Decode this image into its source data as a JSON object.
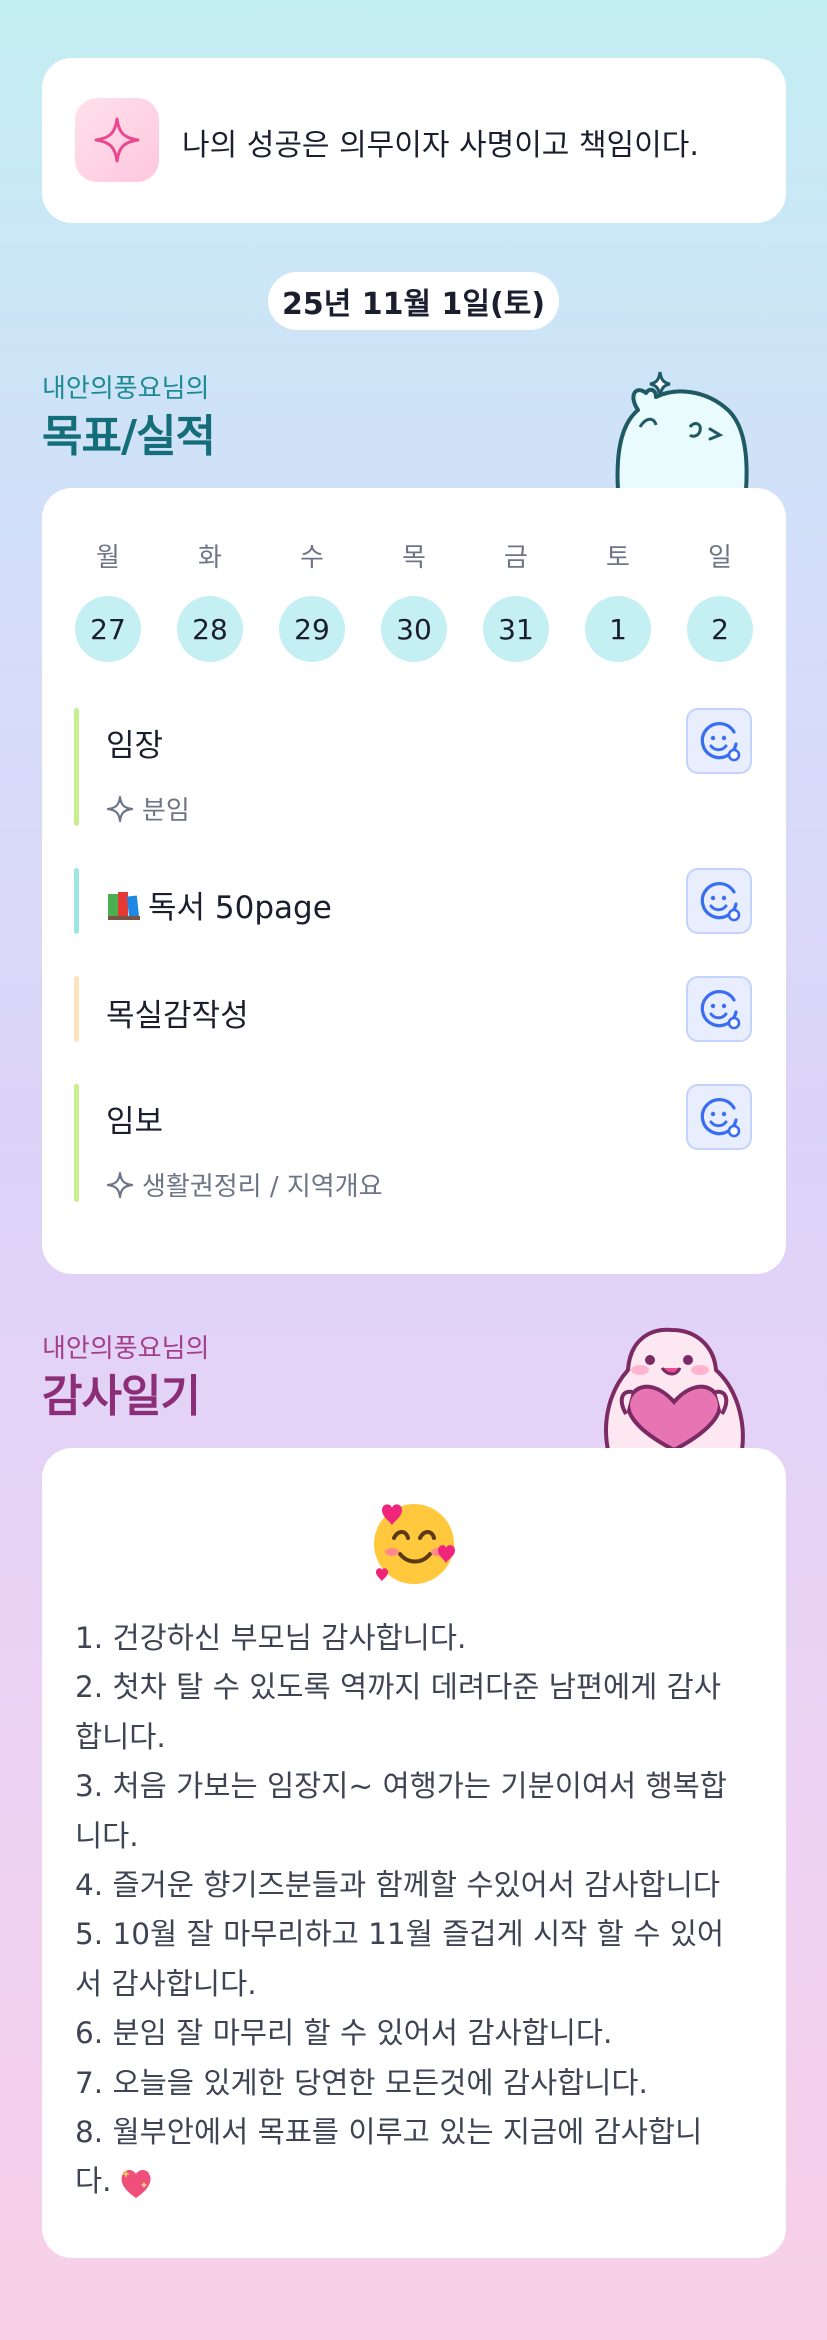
{
  "quote": {
    "text": "나의 성공은 의무이자 사명이고 책임이다.",
    "icon": "sparkle-icon"
  },
  "date": {
    "label": "25년 11월 1일(토)"
  },
  "goals_section": {
    "subtitle": "내안의풍요님의",
    "title": "목표/실적"
  },
  "week": {
    "days": [
      "월",
      "화",
      "수",
      "목",
      "금",
      "토",
      "일"
    ],
    "dates": [
      "27",
      "28",
      "29",
      "30",
      "31",
      "1",
      "2"
    ]
  },
  "goals": [
    {
      "name": "임장",
      "sub": "분임",
      "bar_color": "#c7ee8f"
    },
    {
      "name": "독서 50page",
      "emoji": "books",
      "bar_color": "#9ee6e3"
    },
    {
      "name": "목실감작성",
      "bar_color": "#fde3bd"
    },
    {
      "name": "임보",
      "sub": "생활권정리 / 지역개요",
      "bar_color": "#c7ee8f"
    }
  ],
  "gratitude_section": {
    "subtitle": "내안의풍요님의",
    "title": "감사일기"
  },
  "gratitude": {
    "emoji": "smiling-face-with-hearts",
    "lines": [
      "1. 건강하신 부모님 감사합니다.",
      "2. 첫차 탈 수 있도록 역까지 데려다준 남편에게 감사",
      "합니다.",
      "3. 처음 가보는 임장지~ 여행가는 기분이여서 행복합",
      "니다.",
      "4. 즐거운 향기즈분들과 함께할 수있어서 감사합니다",
      "5. 10월 잘 마무리하고 11월 즐겁게 시작 할 수 있어",
      "서 감사합니다.",
      "6. 분임 잘 마무리 할 수 있어서 감사합니다.",
      "7. 오늘을 있게한  당연한 모든것에 감사합니다.",
      "8. 월부안에서 목표를 이루고 있는 지금에 감사합니",
      "다."
    ]
  },
  "colors": {
    "accent_teal": "#146e79",
    "accent_pink": "#8c2d77",
    "day_circle": "#c4eff3",
    "button_blue": "#3a6ef2"
  }
}
